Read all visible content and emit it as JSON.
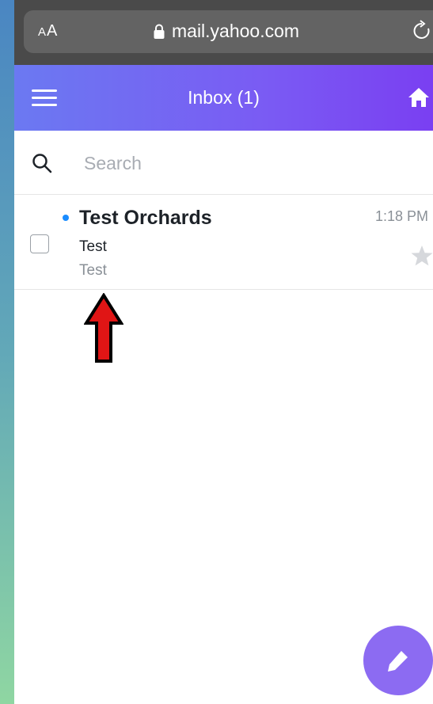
{
  "browser": {
    "text_size_small": "A",
    "text_size_large": "A",
    "url": "mail.yahoo.com"
  },
  "header": {
    "title": "Inbox  (1)"
  },
  "search": {
    "placeholder": "Search"
  },
  "messages": [
    {
      "sender": "Test Orchards",
      "subject": "Test",
      "snippet": "Test",
      "time": "1:18 PM",
      "unread": true,
      "starred": false
    }
  ],
  "colors": {
    "header_start": "#6b79f2",
    "header_end": "#7a3ff2",
    "unread_dot": "#1a8cff",
    "compose_button": "#8c6bf2",
    "arrow": "#e01515"
  },
  "icons": [
    "lock-icon",
    "reload-icon",
    "menu-icon",
    "home-icon",
    "search-icon",
    "star-icon",
    "compose-pencil-icon",
    "up-arrow-annotation"
  ]
}
